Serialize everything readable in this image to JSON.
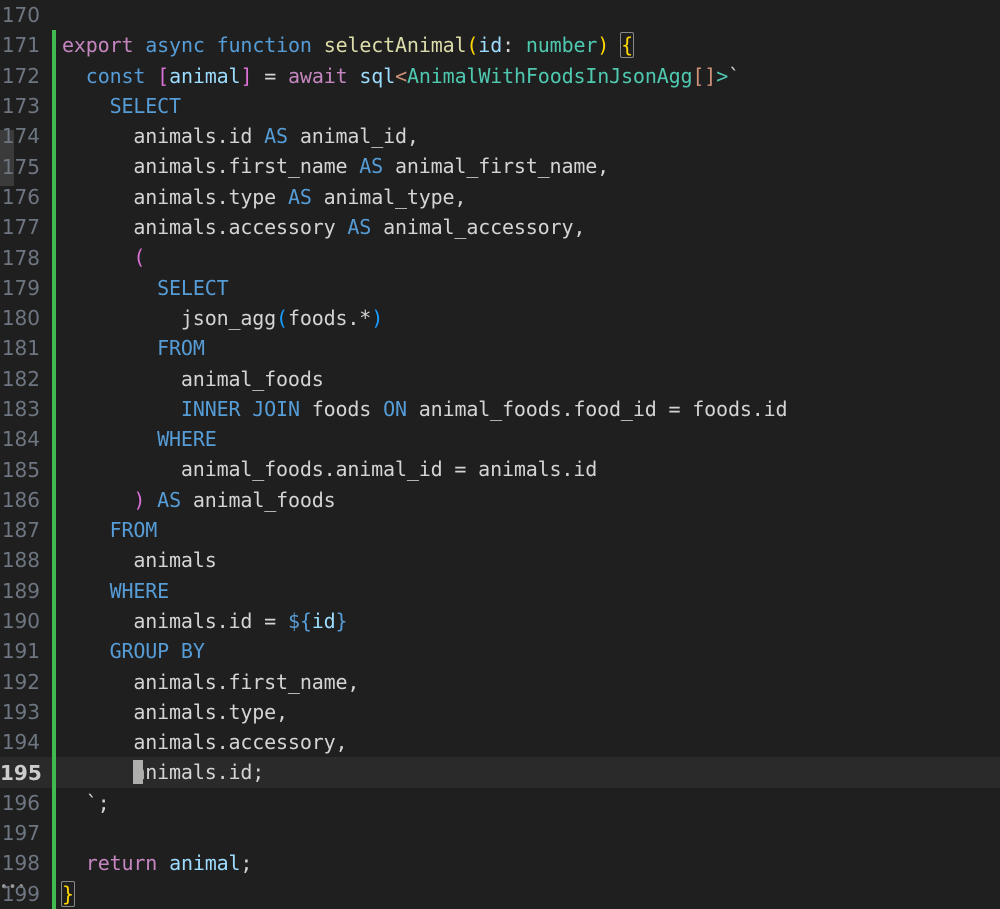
{
  "editor": {
    "app": "code-editor",
    "language": "typescript",
    "active_line": 195,
    "cursor_column": 7,
    "colors": {
      "background": "#1f1f1f",
      "active_line_background": "#2a2a2a",
      "line_number": "#6e7681",
      "line_number_active": "#cccccc",
      "git_modified_bar": "#3fb950",
      "default_text": "#d4d4d4",
      "keyword_pink": "#c586c0",
      "keyword_blue": "#569cd6",
      "function_yellow": "#dcdcaa",
      "variable_light_blue": "#9cdcfe",
      "type_teal": "#4ec9b0",
      "bracket_yellow": "#ffd700",
      "bracket_magenta": "#da70d6",
      "bracket_blue": "#179fff",
      "string_salmon": "#ce9178",
      "cursor": "#aeafad",
      "scrollbar_thumb": "#3b3b3b"
    },
    "overflow_indicator": "•••",
    "lines": [
      {
        "number": "170",
        "modified": false,
        "active": false,
        "tokens": []
      },
      {
        "number": "171",
        "modified": true,
        "active": false,
        "tokens": [
          {
            "text": "export",
            "cls": "t-kw"
          },
          {
            "text": " ",
            "cls": "t-plain"
          },
          {
            "text": "async",
            "cls": "t-ctrl"
          },
          {
            "text": " ",
            "cls": "t-plain"
          },
          {
            "text": "function",
            "cls": "t-ctrl"
          },
          {
            "text": " ",
            "cls": "t-plain"
          },
          {
            "text": "selectAnimal",
            "cls": "t-fn"
          },
          {
            "text": "(",
            "cls": "t-br-yel"
          },
          {
            "text": "id",
            "cls": "t-var"
          },
          {
            "text": ": ",
            "cls": "t-plain"
          },
          {
            "text": "number",
            "cls": "t-type"
          },
          {
            "text": ")",
            "cls": "t-br-yel"
          },
          {
            "text": " ",
            "cls": "t-plain"
          },
          {
            "text": "{",
            "cls": "t-br-yel bracket-match"
          }
        ]
      },
      {
        "number": "172",
        "modified": true,
        "active": false,
        "tokens": [
          {
            "text": "  ",
            "cls": "t-plain"
          },
          {
            "text": "const",
            "cls": "t-ctrl"
          },
          {
            "text": " ",
            "cls": "t-plain"
          },
          {
            "text": "[",
            "cls": "t-br-mag"
          },
          {
            "text": "animal",
            "cls": "t-var"
          },
          {
            "text": "]",
            "cls": "t-br-mag"
          },
          {
            "text": " = ",
            "cls": "t-plain"
          },
          {
            "text": "await",
            "cls": "t-kw"
          },
          {
            "text": " ",
            "cls": "t-plain"
          },
          {
            "text": "sql",
            "cls": "t-var"
          },
          {
            "text": "<",
            "cls": "t-angle"
          },
          {
            "text": "AnimalWithFoodsInJsonAgg",
            "cls": "t-type"
          },
          {
            "text": "[]",
            "cls": "t-str"
          },
          {
            "text": ">",
            "cls": "t-green"
          },
          {
            "text": "`",
            "cls": "t-plain"
          }
        ]
      },
      {
        "number": "173",
        "modified": true,
        "active": false,
        "tokens": [
          {
            "text": "    ",
            "cls": "t-plain"
          },
          {
            "text": "SELECT",
            "cls": "t-ctrl"
          }
        ]
      },
      {
        "number": "174",
        "modified": true,
        "active": false,
        "tokens": [
          {
            "text": "      animals.id ",
            "cls": "t-plain"
          },
          {
            "text": "AS",
            "cls": "t-ctrl"
          },
          {
            "text": " animal_id,",
            "cls": "t-plain"
          }
        ]
      },
      {
        "number": "175",
        "modified": true,
        "active": false,
        "tokens": [
          {
            "text": "      animals.first_name ",
            "cls": "t-plain"
          },
          {
            "text": "AS",
            "cls": "t-ctrl"
          },
          {
            "text": " animal_first_name,",
            "cls": "t-plain"
          }
        ]
      },
      {
        "number": "176",
        "modified": true,
        "active": false,
        "tokens": [
          {
            "text": "      animals.type ",
            "cls": "t-plain"
          },
          {
            "text": "AS",
            "cls": "t-ctrl"
          },
          {
            "text": " animal_type,",
            "cls": "t-plain"
          }
        ]
      },
      {
        "number": "177",
        "modified": true,
        "active": false,
        "tokens": [
          {
            "text": "      animals.accessory ",
            "cls": "t-plain"
          },
          {
            "text": "AS",
            "cls": "t-ctrl"
          },
          {
            "text": " animal_accessory,",
            "cls": "t-plain"
          }
        ]
      },
      {
        "number": "178",
        "modified": true,
        "active": false,
        "tokens": [
          {
            "text": "      ",
            "cls": "t-plain"
          },
          {
            "text": "(",
            "cls": "t-br-mag"
          }
        ]
      },
      {
        "number": "179",
        "modified": true,
        "active": false,
        "tokens": [
          {
            "text": "        ",
            "cls": "t-plain"
          },
          {
            "text": "SELECT",
            "cls": "t-ctrl"
          }
        ]
      },
      {
        "number": "180",
        "modified": true,
        "active": false,
        "tokens": [
          {
            "text": "          json_agg",
            "cls": "t-plain"
          },
          {
            "text": "(",
            "cls": "t-br-blue"
          },
          {
            "text": "foods.*",
            "cls": "t-plain"
          },
          {
            "text": ")",
            "cls": "t-br-blue"
          }
        ]
      },
      {
        "number": "181",
        "modified": true,
        "active": false,
        "tokens": [
          {
            "text": "        ",
            "cls": "t-plain"
          },
          {
            "text": "FROM",
            "cls": "t-ctrl"
          }
        ]
      },
      {
        "number": "182",
        "modified": true,
        "active": false,
        "tokens": [
          {
            "text": "          animal_foods",
            "cls": "t-plain"
          }
        ]
      },
      {
        "number": "183",
        "modified": true,
        "active": false,
        "tokens": [
          {
            "text": "          ",
            "cls": "t-plain"
          },
          {
            "text": "INNER JOIN",
            "cls": "t-ctrl"
          },
          {
            "text": " foods ",
            "cls": "t-plain"
          },
          {
            "text": "ON",
            "cls": "t-ctrl"
          },
          {
            "text": " animal_foods.food_id = foods.id",
            "cls": "t-plain"
          }
        ]
      },
      {
        "number": "184",
        "modified": true,
        "active": false,
        "tokens": [
          {
            "text": "        ",
            "cls": "t-plain"
          },
          {
            "text": "WHERE",
            "cls": "t-ctrl"
          }
        ]
      },
      {
        "number": "185",
        "modified": true,
        "active": false,
        "tokens": [
          {
            "text": "          animal_foods.animal_id = animals.id",
            "cls": "t-plain"
          }
        ]
      },
      {
        "number": "186",
        "modified": true,
        "active": false,
        "tokens": [
          {
            "text": "      ",
            "cls": "t-plain"
          },
          {
            "text": ")",
            "cls": "t-br-mag"
          },
          {
            "text": " ",
            "cls": "t-plain"
          },
          {
            "text": "AS",
            "cls": "t-ctrl"
          },
          {
            "text": " animal_foods",
            "cls": "t-plain"
          }
        ]
      },
      {
        "number": "187",
        "modified": true,
        "active": false,
        "tokens": [
          {
            "text": "    ",
            "cls": "t-plain"
          },
          {
            "text": "FROM",
            "cls": "t-ctrl"
          }
        ]
      },
      {
        "number": "188",
        "modified": true,
        "active": false,
        "tokens": [
          {
            "text": "      animals",
            "cls": "t-plain"
          }
        ]
      },
      {
        "number": "189",
        "modified": true,
        "active": false,
        "tokens": [
          {
            "text": "    ",
            "cls": "t-plain"
          },
          {
            "text": "WHERE",
            "cls": "t-ctrl"
          }
        ]
      },
      {
        "number": "190",
        "modified": true,
        "active": false,
        "tokens": [
          {
            "text": "      animals.id = ",
            "cls": "t-plain"
          },
          {
            "text": "${",
            "cls": "t-ctrl"
          },
          {
            "text": "id",
            "cls": "t-var"
          },
          {
            "text": "}",
            "cls": "t-ctrl"
          }
        ]
      },
      {
        "number": "191",
        "modified": true,
        "active": false,
        "tokens": [
          {
            "text": "    ",
            "cls": "t-plain"
          },
          {
            "text": "GROUP BY",
            "cls": "t-ctrl"
          }
        ]
      },
      {
        "number": "192",
        "modified": true,
        "active": false,
        "tokens": [
          {
            "text": "      animals.first_name,",
            "cls": "t-plain"
          }
        ]
      },
      {
        "number": "193",
        "modified": true,
        "active": false,
        "tokens": [
          {
            "text": "      animals.type,",
            "cls": "t-plain"
          }
        ]
      },
      {
        "number": "194",
        "modified": true,
        "active": false,
        "tokens": [
          {
            "text": "      animals.accessory,",
            "cls": "t-plain"
          }
        ]
      },
      {
        "number": "195",
        "modified": true,
        "active": true,
        "cursor_before": 6,
        "tokens": [
          {
            "text": "      ",
            "cls": "t-plain"
          },
          {
            "text": "animals.id;",
            "cls": "t-plain"
          }
        ]
      },
      {
        "number": "196",
        "modified": true,
        "active": false,
        "tokens": [
          {
            "text": "  `;",
            "cls": "t-plain"
          }
        ]
      },
      {
        "number": "197",
        "modified": true,
        "active": false,
        "tokens": []
      },
      {
        "number": "198",
        "modified": true,
        "active": false,
        "tokens": [
          {
            "text": "  ",
            "cls": "t-plain"
          },
          {
            "text": "return",
            "cls": "t-kw"
          },
          {
            "text": " ",
            "cls": "t-plain"
          },
          {
            "text": "animal",
            "cls": "t-var"
          },
          {
            "text": ";",
            "cls": "t-plain"
          }
        ]
      },
      {
        "number": "199",
        "modified": true,
        "active": false,
        "tokens": [
          {
            "text": "}",
            "cls": "t-br-yel bracket-match"
          }
        ]
      }
    ]
  }
}
